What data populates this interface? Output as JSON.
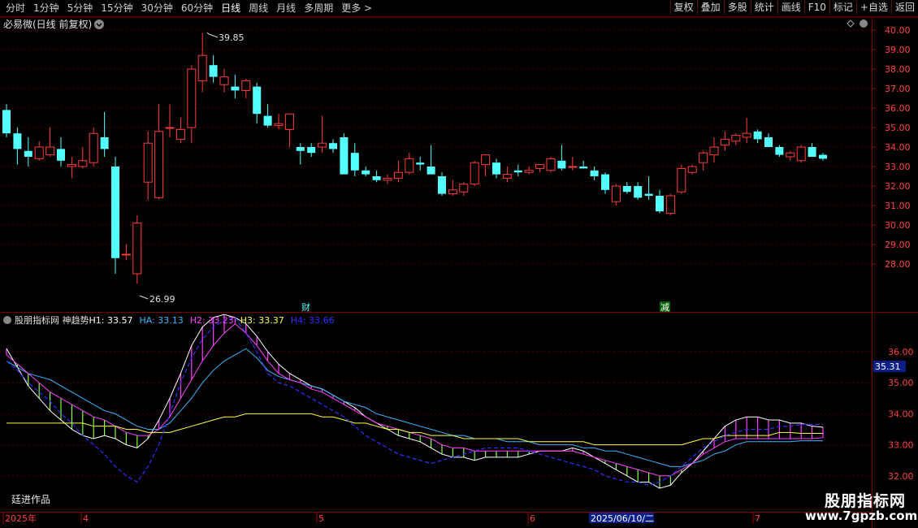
{
  "toolbar": {
    "periods": [
      "分时",
      "1分钟",
      "5分钟",
      "15分钟",
      "30分钟",
      "60分钟",
      "日线",
      "周线",
      "月线",
      "多周期",
      "更多"
    ],
    "active_period": "日线",
    "more_arrow": ">",
    "buttons": [
      "复权",
      "叠加",
      "多股",
      "统计",
      "画线",
      "F10",
      "标记",
      "+自选",
      "返回"
    ]
  },
  "main_chart": {
    "title": "必易微(日线 前复权)",
    "high_label": "39.85",
    "low_label": "26.99",
    "price_ticks": [
      "40.00",
      "39.00",
      "38.00",
      "37.00",
      "36.00",
      "35.00",
      "34.00",
      "33.00",
      "32.00",
      "31.00",
      "30.00",
      "29.00",
      "28.00"
    ],
    "event_markers": [
      "财",
      "减"
    ]
  },
  "indicator": {
    "name": "股朋指标网",
    "formula": "神趋势",
    "values": [
      {
        "label": "H1: 33.57",
        "color": "#ffffff"
      },
      {
        "label": "HA: 33.13",
        "color": "#3ab4ff"
      },
      {
        "label": "H2: 33.23",
        "color": "#ff40ff"
      },
      {
        "label": "H3: 33.37",
        "color": "#ffff40"
      },
      {
        "label": "H4: 33.66",
        "color": "#3030ff"
      }
    ],
    "ticks": [
      "36.00",
      "35.00",
      "34.00",
      "33.00",
      "32.00"
    ],
    "current_value": "35.31",
    "author_note": "廷进作品"
  },
  "time_axis": {
    "labels": [
      "2025年",
      "4",
      "5",
      "6",
      "7"
    ],
    "cursor_date": "2025/06/10/二"
  },
  "watermark": {
    "title": "股朋指标网",
    "url": "www.7gpzb.com"
  },
  "colors": {
    "up": "#ff3b3b",
    "down": "#54ffff",
    "background": "#000000",
    "grid": "#6a0000"
  },
  "chart_data": {
    "type": "candlestick",
    "title": "必易微(日线 前复权)",
    "ylim": [
      27.5,
      40.3
    ],
    "candles": [
      {
        "o": 35.9,
        "h": 36.2,
        "l": 34.5,
        "c": 34.7
      },
      {
        "o": 34.7,
        "h": 35.0,
        "l": 33.1,
        "c": 33.9
      },
      {
        "o": 33.8,
        "h": 34.5,
        "l": 33.0,
        "c": 33.5
      },
      {
        "o": 33.4,
        "h": 34.3,
        "l": 33.3,
        "c": 34.0
      },
      {
        "o": 33.6,
        "h": 35.0,
        "l": 33.5,
        "c": 34.0
      },
      {
        "o": 33.9,
        "h": 34.5,
        "l": 33.0,
        "c": 33.3
      },
      {
        "o": 33.0,
        "h": 33.5,
        "l": 32.4,
        "c": 33.1
      },
      {
        "o": 33.0,
        "h": 34.0,
        "l": 32.9,
        "c": 33.3
      },
      {
        "o": 33.2,
        "h": 35.0,
        "l": 33.0,
        "c": 34.7
      },
      {
        "o": 34.5,
        "h": 35.8,
        "l": 33.5,
        "c": 33.9
      },
      {
        "o": 33.0,
        "h": 33.5,
        "l": 27.5,
        "c": 28.3
      },
      {
        "o": 28.5,
        "h": 29.0,
        "l": 28.2,
        "c": 28.5
      },
      {
        "o": 27.5,
        "h": 30.5,
        "l": 26.99,
        "c": 30.1
      },
      {
        "o": 32.2,
        "h": 34.8,
        "l": 31.3,
        "c": 34.2
      },
      {
        "o": 31.4,
        "h": 36.2,
        "l": 31.3,
        "c": 34.8
      },
      {
        "o": 35.0,
        "h": 36.2,
        "l": 34.5,
        "c": 35.0
      },
      {
        "o": 34.4,
        "h": 35.5,
        "l": 34.2,
        "c": 34.9
      },
      {
        "o": 35.0,
        "h": 38.2,
        "l": 34.2,
        "c": 38.0
      },
      {
        "o": 37.4,
        "h": 39.85,
        "l": 36.8,
        "c": 38.7
      },
      {
        "o": 38.2,
        "h": 38.7,
        "l": 37.3,
        "c": 37.6
      },
      {
        "o": 37.2,
        "h": 38.0,
        "l": 36.8,
        "c": 37.6
      },
      {
        "o": 37.1,
        "h": 37.7,
        "l": 36.5,
        "c": 36.9
      },
      {
        "o": 36.9,
        "h": 37.5,
        "l": 36.5,
        "c": 37.4
      },
      {
        "o": 37.1,
        "h": 37.3,
        "l": 35.2,
        "c": 35.7
      },
      {
        "o": 35.6,
        "h": 36.2,
        "l": 35.0,
        "c": 35.1
      },
      {
        "o": 35.1,
        "h": 35.7,
        "l": 34.9,
        "c": 35.2
      },
      {
        "o": 34.9,
        "h": 35.5,
        "l": 34.0,
        "c": 35.7
      },
      {
        "o": 34.0,
        "h": 34.2,
        "l": 33.1,
        "c": 33.8
      },
      {
        "o": 34.0,
        "h": 34.2,
        "l": 33.5,
        "c": 33.7
      },
      {
        "o": 34.0,
        "h": 35.6,
        "l": 33.7,
        "c": 34.2
      },
      {
        "o": 34.2,
        "h": 34.4,
        "l": 33.7,
        "c": 33.9
      },
      {
        "o": 34.5,
        "h": 34.7,
        "l": 32.9,
        "c": 32.6
      },
      {
        "o": 33.7,
        "h": 34.2,
        "l": 32.5,
        "c": 32.8
      },
      {
        "o": 32.8,
        "h": 33.0,
        "l": 32.5,
        "c": 32.6
      },
      {
        "o": 32.5,
        "h": 32.8,
        "l": 32.2,
        "c": 32.3
      },
      {
        "o": 32.3,
        "h": 32.6,
        "l": 32.1,
        "c": 32.4
      },
      {
        "o": 32.4,
        "h": 33.3,
        "l": 32.2,
        "c": 32.7
      },
      {
        "o": 32.7,
        "h": 33.7,
        "l": 32.6,
        "c": 33.4
      },
      {
        "o": 33.2,
        "h": 33.5,
        "l": 32.8,
        "c": 33.1
      },
      {
        "o": 33.0,
        "h": 34.1,
        "l": 32.7,
        "c": 32.6
      },
      {
        "o": 32.5,
        "h": 32.7,
        "l": 31.5,
        "c": 31.6
      },
      {
        "o": 31.6,
        "h": 32.3,
        "l": 31.5,
        "c": 31.8
      },
      {
        "o": 31.7,
        "h": 32.2,
        "l": 31.5,
        "c": 32.1
      },
      {
        "o": 32.1,
        "h": 33.3,
        "l": 32.0,
        "c": 33.2
      },
      {
        "o": 33.1,
        "h": 33.6,
        "l": 32.5,
        "c": 33.6
      },
      {
        "o": 33.2,
        "h": 33.4,
        "l": 32.4,
        "c": 32.6
      },
      {
        "o": 32.4,
        "h": 33.0,
        "l": 32.2,
        "c": 32.6
      },
      {
        "o": 32.8,
        "h": 33.1,
        "l": 32.5,
        "c": 32.7
      },
      {
        "o": 32.7,
        "h": 33.0,
        "l": 32.6,
        "c": 32.8
      },
      {
        "o": 32.9,
        "h": 33.1,
        "l": 32.7,
        "c": 33.1
      },
      {
        "o": 32.8,
        "h": 33.5,
        "l": 32.7,
        "c": 33.4
      },
      {
        "o": 33.3,
        "h": 34.1,
        "l": 32.8,
        "c": 32.9
      },
      {
        "o": 33.0,
        "h": 33.5,
        "l": 32.8,
        "c": 33.0
      },
      {
        "o": 33.0,
        "h": 33.3,
        "l": 32.9,
        "c": 32.9
      },
      {
        "o": 32.8,
        "h": 33.0,
        "l": 32.3,
        "c": 32.5
      },
      {
        "o": 32.6,
        "h": 32.7,
        "l": 31.6,
        "c": 31.8
      },
      {
        "o": 31.2,
        "h": 32.1,
        "l": 31.0,
        "c": 32.0
      },
      {
        "o": 32.0,
        "h": 32.2,
        "l": 31.6,
        "c": 31.7
      },
      {
        "o": 32.0,
        "h": 32.2,
        "l": 31.3,
        "c": 31.4
      },
      {
        "o": 31.6,
        "h": 32.5,
        "l": 31.3,
        "c": 31.5
      },
      {
        "o": 31.5,
        "h": 31.8,
        "l": 30.6,
        "c": 30.7
      },
      {
        "o": 30.6,
        "h": 31.6,
        "l": 30.5,
        "c": 31.5
      },
      {
        "o": 31.7,
        "h": 33.1,
        "l": 31.6,
        "c": 32.9
      },
      {
        "o": 32.7,
        "h": 33.1,
        "l": 32.6,
        "c": 33.0
      },
      {
        "o": 33.2,
        "h": 33.8,
        "l": 32.8,
        "c": 33.7
      },
      {
        "o": 33.6,
        "h": 34.5,
        "l": 33.2,
        "c": 34.0
      },
      {
        "o": 34.1,
        "h": 34.8,
        "l": 33.8,
        "c": 34.4
      },
      {
        "o": 34.3,
        "h": 34.7,
        "l": 34.1,
        "c": 34.6
      },
      {
        "o": 34.5,
        "h": 35.5,
        "l": 34.2,
        "c": 34.7
      },
      {
        "o": 34.8,
        "h": 34.9,
        "l": 34.2,
        "c": 34.4
      },
      {
        "o": 34.5,
        "h": 34.7,
        "l": 34.0,
        "c": 34.0
      },
      {
        "o": 34.0,
        "h": 34.1,
        "l": 33.5,
        "c": 33.6
      },
      {
        "o": 33.5,
        "h": 33.8,
        "l": 33.3,
        "c": 33.7
      },
      {
        "o": 33.3,
        "h": 34.1,
        "l": 33.2,
        "c": 34.0
      },
      {
        "o": 34.0,
        "h": 34.2,
        "l": 33.5,
        "c": 33.5
      },
      {
        "o": 33.6,
        "h": 33.7,
        "l": 33.3,
        "c": 33.4
      }
    ],
    "indicator_ylim": [
      31.6,
      37.2
    ],
    "indicator_series": [
      {
        "name": "H1",
        "color": "#ffffff",
        "values": [
          36.1,
          35.5,
          34.9,
          34.5,
          34.1,
          33.8,
          33.5,
          33.3,
          33.2,
          33.3,
          33.2,
          33.0,
          32.9,
          33.2,
          33.8,
          34.5,
          35.3,
          36.2,
          36.8,
          37.1,
          37.2,
          37.1,
          36.9,
          36.5,
          36.0,
          35.6,
          35.3,
          35.1,
          34.9,
          34.8,
          34.6,
          34.4,
          34.2,
          33.9,
          33.7,
          33.5,
          33.3,
          33.2,
          33.1,
          32.9,
          32.7,
          32.6,
          32.6,
          32.5,
          32.6,
          32.6,
          32.6,
          32.6,
          32.7,
          32.8,
          32.8,
          32.8,
          32.9,
          32.8,
          32.6,
          32.4,
          32.2,
          32.0,
          31.8,
          31.8,
          31.6,
          31.7,
          32.1,
          32.4,
          32.8,
          33.2,
          33.6,
          33.8,
          33.9,
          33.9,
          33.8,
          33.8,
          33.7,
          33.7,
          33.6,
          33.57
        ]
      },
      {
        "name": "HA",
        "color": "#3ab4ff",
        "values": [
          35.7,
          35.5,
          35.3,
          35.2,
          35.1,
          34.9,
          34.7,
          34.5,
          34.3,
          34.1,
          34.0,
          33.8,
          33.6,
          33.5,
          33.5,
          33.7,
          34.1,
          34.5,
          35.0,
          35.4,
          35.7,
          35.9,
          36.1,
          35.8,
          35.4,
          35.2,
          35.1,
          35.0,
          34.9,
          34.8,
          34.6,
          34.4,
          34.3,
          34.2,
          34.0,
          33.9,
          33.8,
          33.7,
          33.6,
          33.5,
          33.4,
          33.3,
          33.3,
          33.2,
          33.2,
          33.2,
          33.1,
          33.1,
          33.1,
          33.0,
          33.0,
          33.0,
          33.0,
          32.9,
          32.9,
          32.8,
          32.8,
          32.7,
          32.6,
          32.5,
          32.4,
          32.3,
          32.3,
          32.4,
          32.5,
          32.7,
          32.8,
          33.0,
          33.1,
          33.1,
          33.1,
          33.1,
          33.1,
          33.13,
          33.13,
          33.13
        ]
      },
      {
        "name": "H2",
        "color": "#ff40ff",
        "values": [
          35.9,
          35.6,
          35.3,
          35.0,
          34.7,
          34.5,
          34.3,
          34.1,
          33.9,
          33.8,
          33.6,
          33.4,
          33.3,
          33.3,
          33.5,
          33.9,
          34.5,
          35.1,
          35.7,
          36.2,
          36.6,
          36.9,
          36.6,
          36.2,
          35.7,
          35.3,
          35.1,
          35.0,
          34.8,
          34.7,
          34.5,
          34.3,
          34.1,
          33.9,
          33.7,
          33.6,
          33.5,
          33.4,
          33.3,
          33.2,
          33.0,
          32.9,
          32.9,
          32.8,
          32.8,
          32.8,
          32.8,
          32.8,
          32.8,
          32.8,
          32.8,
          32.8,
          32.8,
          32.7,
          32.6,
          32.5,
          32.4,
          32.3,
          32.2,
          32.1,
          32.0,
          32.0,
          32.2,
          32.4,
          32.7,
          32.9,
          33.1,
          33.2,
          33.2,
          33.2,
          33.2,
          33.2,
          33.2,
          33.2,
          33.2,
          33.23
        ]
      },
      {
        "name": "H3",
        "color": "#ffff40",
        "values": [
          33.7,
          33.7,
          33.7,
          33.7,
          33.7,
          33.7,
          33.7,
          33.7,
          33.6,
          33.6,
          33.6,
          33.5,
          33.5,
          33.4,
          33.4,
          33.4,
          33.5,
          33.6,
          33.7,
          33.8,
          33.9,
          33.9,
          34.0,
          34.0,
          34.0,
          34.0,
          34.0,
          34.0,
          34.0,
          33.9,
          33.9,
          33.8,
          33.7,
          33.7,
          33.6,
          33.5,
          33.5,
          33.4,
          33.4,
          33.3,
          33.3,
          33.3,
          33.2,
          33.2,
          33.2,
          33.2,
          33.2,
          33.2,
          33.1,
          33.1,
          33.1,
          33.1,
          33.1,
          33.1,
          33.0,
          33.0,
          33.0,
          33.0,
          33.0,
          33.0,
          33.0,
          33.0,
          33.0,
          33.1,
          33.2,
          33.2,
          33.3,
          33.3,
          33.3,
          33.3,
          33.3,
          33.4,
          33.4,
          33.37,
          33.37,
          33.37
        ]
      },
      {
        "name": "H4",
        "color": "#3030ff",
        "values": [
          35.7,
          35.4,
          35.0,
          34.7,
          34.4,
          34.0,
          33.7,
          33.3,
          33.0,
          32.7,
          32.3,
          32.0,
          31.8,
          32.3,
          33.0,
          34.0,
          35.0,
          35.8,
          36.4,
          36.8,
          37.0,
          37.1,
          36.6,
          36.0,
          35.3,
          35.0,
          34.9,
          34.7,
          34.5,
          34.3,
          34.1,
          33.9,
          33.6,
          33.3,
          33.1,
          32.9,
          32.7,
          32.6,
          32.5,
          32.4,
          32.5,
          32.6,
          32.7,
          32.8,
          32.9,
          32.9,
          32.9,
          32.9,
          32.8,
          32.7,
          32.6,
          32.5,
          32.4,
          32.3,
          32.2,
          32.0,
          31.9,
          31.8,
          31.8,
          31.7,
          31.8,
          32.0,
          32.3,
          32.6,
          32.9,
          33.1,
          33.3,
          33.4,
          33.5,
          33.5,
          33.5,
          33.6,
          33.6,
          33.66,
          33.66,
          33.66
        ]
      }
    ]
  }
}
